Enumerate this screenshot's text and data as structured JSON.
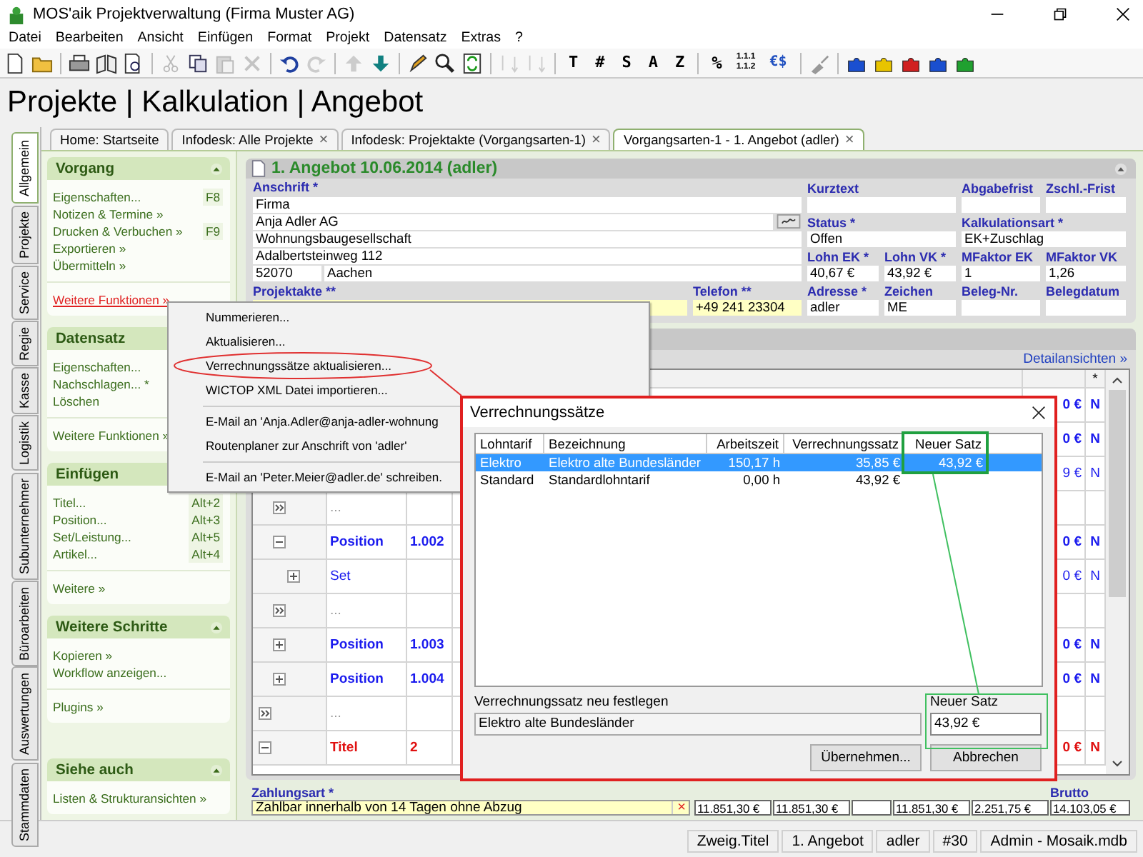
{
  "window": {
    "title": "MOS'aik Projektverwaltung (Firma Muster AG)"
  },
  "menu": [
    "Datei",
    "Bearbeiten",
    "Ansicht",
    "Einfügen",
    "Format",
    "Projekt",
    "Datensatz",
    "Extras",
    "?"
  ],
  "toolbar": {
    "glyphs": [
      "T",
      "#",
      "S",
      "A",
      "Z"
    ],
    "percent": "%",
    "numbering": [
      "1.1.1",
      "1.1.2"
    ],
    "currency": "€$"
  },
  "breadcrumb": "Projekte | Kalkulation | Angebot",
  "side_tabs": [
    {
      "label": "Allgemein",
      "selected": true
    },
    {
      "label": "Projekte",
      "selected": false
    },
    {
      "label": "Service",
      "selected": false
    },
    {
      "label": "Regie",
      "selected": false
    },
    {
      "label": "Kasse",
      "selected": false
    },
    {
      "label": "Logistik",
      "selected": false
    },
    {
      "label": "Subunternehmer",
      "selected": false
    },
    {
      "label": "Büroarbeiten",
      "selected": false
    },
    {
      "label": "Auswertungen",
      "selected": false
    },
    {
      "label": "Stammdaten",
      "selected": false
    }
  ],
  "tabs": [
    {
      "label": "Home: Startseite",
      "selected": false
    },
    {
      "label": "Infodesk: Alle Projekte",
      "close": "×",
      "selected": false
    },
    {
      "label": "Infodesk: Projektakte (Vorgangsarten-1)",
      "close": "×",
      "selected": false
    },
    {
      "label": "Vorgangsarten-1 - 1. Angebot (adler)",
      "close": "×",
      "selected": true
    }
  ],
  "task_pane": [
    {
      "title": "Vorgang",
      "groups": [
        [
          {
            "label": "Eigenschaften...",
            "shortcut": "F8",
            "active": false
          },
          {
            "label": "Notizen & Termine »",
            "active": false
          },
          {
            "label": "Drucken & Verbuchen »",
            "shortcut": "F9",
            "active": false
          },
          {
            "label": "Exportieren »",
            "active": false
          },
          {
            "label": "Übermitteln »",
            "active": false
          }
        ],
        [
          {
            "label": "Weitere Funktionen »",
            "active": true
          }
        ]
      ]
    },
    {
      "title": "Datensatz",
      "groups": [
        [
          {
            "label": "Eigenschaften...",
            "active": false
          },
          {
            "label": "Nachschlagen... *",
            "active": false
          },
          {
            "label": "Löschen",
            "active": false
          }
        ],
        [
          {
            "label": "Weitere Funktionen »",
            "active": false
          }
        ]
      ]
    },
    {
      "title": "Einfügen",
      "groups": [
        [
          {
            "label": "Titel...",
            "shortcut": "Alt+2",
            "active": false
          },
          {
            "label": "Position...",
            "shortcut": "Alt+3",
            "active": false
          },
          {
            "label": "Set/Leistung...",
            "shortcut": "Alt+5",
            "active": false
          },
          {
            "label": "Artikel...",
            "shortcut": "Alt+4",
            "active": false
          }
        ],
        [
          {
            "label": "Weitere »",
            "active": false
          }
        ]
      ]
    },
    {
      "title": "Weitere Schritte",
      "groups": [
        [
          {
            "label": "Kopieren »",
            "active": false
          },
          {
            "label": "Workflow anzeigen...",
            "active": false
          }
        ],
        [
          {
            "label": "Plugins »",
            "active": false
          }
        ]
      ]
    },
    {
      "title": "Siehe auch",
      "groups": [
        [
          {
            "label": "Listen & Strukturansichten »",
            "active": false
          }
        ]
      ]
    }
  ],
  "offer": {
    "title": "1. Angebot 10.06.2014 (adler)",
    "address": {
      "label": "Anschrift *",
      "lines": [
        "Firma",
        "Anja Adler AG",
        "Wohnungsbaugesellschaft",
        "Adalbertsteinweg 112"
      ],
      "zip": "52070",
      "city": "Aachen"
    },
    "kurztext": {
      "label": "Kurztext"
    },
    "abgabefrist": {
      "label": "Abgabefrist"
    },
    "zschl_frist": {
      "label": "Zschl.-Frist"
    },
    "status": {
      "label": "Status *",
      "value": "Offen"
    },
    "kalkulationsart": {
      "label": "Kalkulationsart *",
      "value": "EK+Zuschlag"
    },
    "lohn_ek": {
      "label": "Lohn EK *",
      "value": "40,67 €"
    },
    "lohn_vk": {
      "label": "Lohn VK *",
      "value": "43,92 €"
    },
    "mfaktor_ek": {
      "label": "MFaktor EK",
      "value": "1"
    },
    "mfaktor_vk": {
      "label": "MFaktor VK",
      "value": "1,26"
    },
    "projektakte": {
      "label": "Projektakte **",
      "highlighted": true
    },
    "telefon": {
      "label": "Telefon **",
      "value": "+49 241 23304",
      "highlighted": true
    },
    "adresse": {
      "label": "Adresse *",
      "value": "adler"
    },
    "zeichen": {
      "label": "Zeichen",
      "value": "ME"
    },
    "beleg_nr": {
      "label": "Beleg-Nr."
    },
    "belegdatum": {
      "label": "Belegdatum"
    }
  },
  "details_link": "Detailansichten »",
  "table": {
    "star_header": "*",
    "rows": [
      {
        "kind": "branch",
        "children": [
          {
            "kind": "position",
            "amount": "0 €",
            "flag": "N"
          },
          {
            "kind": "position",
            "amount": "0 €",
            "flag": "N"
          },
          {
            "kind": "set",
            "amount": "9 €",
            "flag": "N"
          },
          {
            "kind": "ellipsis",
            "type": "..."
          },
          {
            "kind": "position",
            "expanded": true,
            "type": "Position",
            "number": "1.002",
            "amount": "0 €",
            "flag": "N",
            "children": [
              {
                "kind": "set",
                "expanded": false,
                "type": "Set",
                "amount": "0 €",
                "flag": "N"
              }
            ]
          },
          {
            "kind": "ellipsis",
            "type": "..."
          },
          {
            "kind": "position",
            "expanded": false,
            "type": "Position",
            "number": "1.003",
            "amount": "0 €",
            "flag": "N"
          },
          {
            "kind": "position",
            "expanded": false,
            "type": "Position",
            "number": "1.004",
            "amount": "0 €",
            "flag": "N"
          }
        ]
      },
      {
        "kind": "ellipsis",
        "type": "..."
      },
      {
        "kind": "title",
        "expanded": true,
        "type": "Titel",
        "number": "2",
        "amount": "0 €",
        "flag": "N"
      }
    ]
  },
  "payment": {
    "label": "Zahlungsart *",
    "value": "Zahlbar innerhalb von 14 Tagen ohne Abzug",
    "clear": "×"
  },
  "totals": {
    "label": "Brutto",
    "fields": [
      {
        "kind": "value",
        "value": "11.851,30 €"
      },
      {
        "kind": "value",
        "value": "11.851,30 €"
      },
      {
        "kind": "blank"
      },
      {
        "kind": "value",
        "value": "11.851,30 €"
      },
      {
        "kind": "value",
        "value": "2.251,75 €"
      },
      {
        "kind": "value",
        "value": "14.103,05 €"
      }
    ]
  },
  "status_bar": [
    "Zweig.Titel",
    "1. Angebot",
    "adler",
    "#30",
    "Admin - Mosaik.mdb"
  ],
  "context_menu": [
    {
      "kind": "item",
      "label": "Nummerieren..."
    },
    {
      "kind": "item",
      "label": "Aktualisieren..."
    },
    {
      "kind": "item",
      "label": "Verrechnungssätze aktualisieren..."
    },
    {
      "kind": "item",
      "label": "WICTOP XML Datei importieren..."
    },
    {
      "kind": "separator"
    },
    {
      "kind": "item",
      "label": "E-Mail an 'Anja.Adler@anja-adler-wohnung"
    },
    {
      "kind": "item",
      "label": "Routenplaner zur Anschrift von 'adler'"
    },
    {
      "kind": "separator"
    },
    {
      "kind": "item",
      "label": "E-Mail an 'Peter.Meier@adler.de' schreiben."
    }
  ],
  "dialog": {
    "title": "Verrechnungssätze",
    "columns": [
      "Lohntarif",
      "Bezeichnung",
      "Arbeitszeit",
      "Verrechnungssatz",
      "Neuer Satz"
    ],
    "rows": [
      {
        "cells": [
          "Elektro",
          "Elektro alte Bundesländer",
          "150,17 h",
          "35,85 €",
          "43,92 €"
        ],
        "selected": true
      },
      {
        "cells": [
          "Standard",
          "Standardlohntarif",
          "0,00 h",
          "43,92 €"
        ],
        "selected": false
      }
    ],
    "rate_label": "Verrechnungssatz neu festlegen",
    "rate_value": "Elektro alte Bundesländer",
    "new_rate_label": "Neuer Satz",
    "new_rate_value": "43,92 €",
    "buttons": [
      "Übernehmen...",
      "Abbrechen"
    ]
  }
}
